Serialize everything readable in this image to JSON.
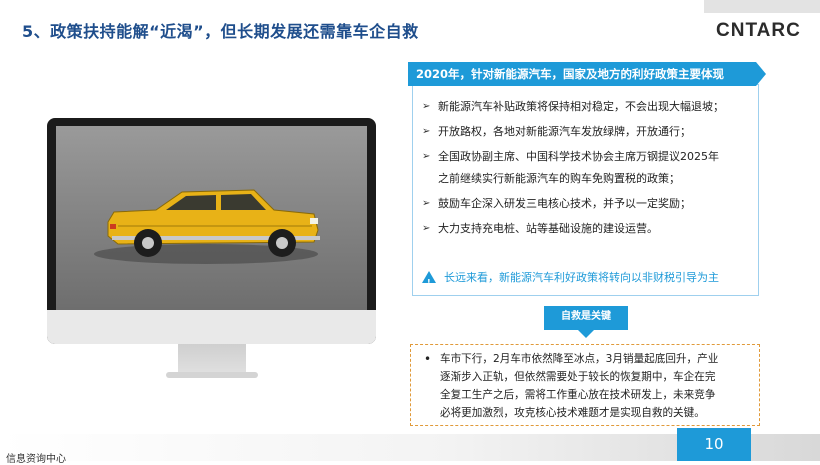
{
  "header": {
    "title": "5、政策扶持能解“近渴”，但长期发展还需靠车企自救",
    "logo": "CNTARC"
  },
  "panel": {
    "title": "2020年，针对新能源汽车，国家及地方的利好政策主要体现",
    "bullets": [
      "新能源汽车补贴政策将保持相对稳定，不会出现大幅退坡；",
      "开放路权，各地对新能源汽车发放绿牌，开放通行；",
      "全国政协副主席、中国科学技术协会主席万钢提议2025年",
      "之前继续实行新能源汽车的购车免购置税的政策；",
      "鼓励车企深入研发三电核心技术，并予以一定奖励；",
      "大力支持充电桩、站等基础设施的建设运营。"
    ],
    "note": "长远来看，新能源汽车利好政策将转向以非财税引导为主",
    "note_icon": "!"
  },
  "key": {
    "tag": "自救是关键",
    "text_lines": [
      "车市下行，2月车市依然降至冰点，3月销量起底回升，产业",
      "逐渐步入正轨，但依然需要处于较长的恢复期中，车企在完",
      "全复工生产之后，需将工作重心放在技术研发上，未来竞争",
      "必将更加激烈，攻克核心技术难题才是实现自救的关键。"
    ]
  },
  "footer": {
    "org": "信息资询中心",
    "page": "10"
  },
  "colors": {
    "accent": "#1e9ad8",
    "title": "#1f4e8c",
    "car": "#e8b217",
    "dashed_border": "#e09a3a"
  }
}
